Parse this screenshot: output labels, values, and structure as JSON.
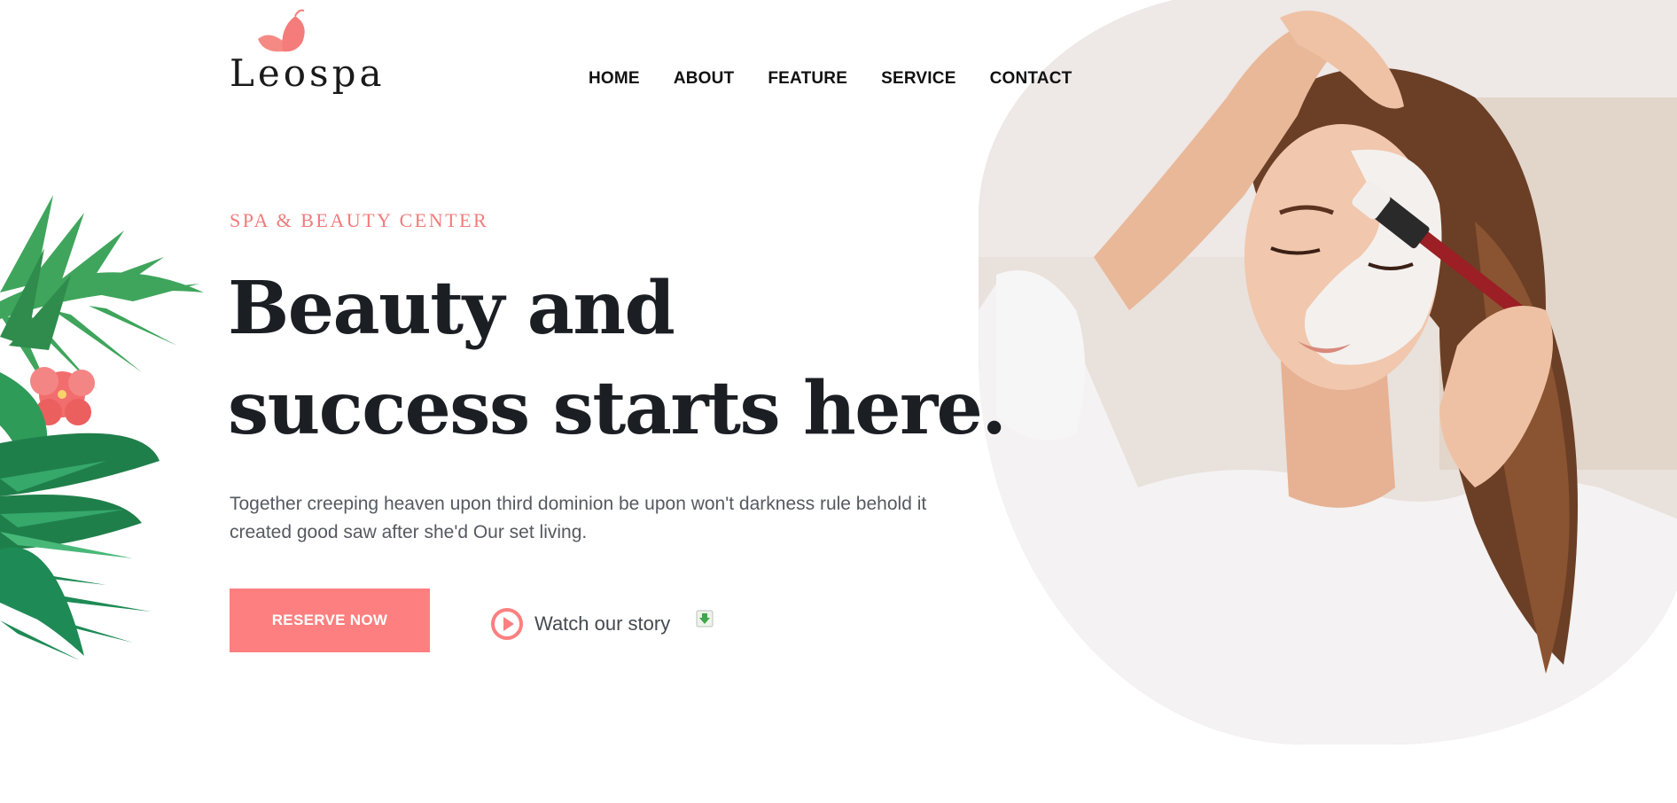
{
  "brand": {
    "name": "Leospa",
    "logo_icon": "butterfly-icon",
    "accent_color": "#fd7f7f"
  },
  "nav": {
    "items": [
      {
        "label": "HOME"
      },
      {
        "label": "ABOUT"
      },
      {
        "label": "FEATURE"
      },
      {
        "label": "SERVICE"
      },
      {
        "label": "CONTACT"
      }
    ]
  },
  "hero": {
    "eyebrow": "SPA & BEAUTY CENTER",
    "headline_line1": "Beauty and",
    "headline_line2": "success starts here.",
    "description": "Together creeping heaven upon third dominion be upon won't darkness rule behold it created good saw after she'd Our set living.",
    "cta_label": "RESERVE NOW",
    "watch_label": "Watch our story",
    "watch_icon": "play-circle-icon",
    "extra_icon": "download-icon",
    "image_icon": "face-mask-photo",
    "decor_icon": "tropical-leaves-icon"
  },
  "colors": {
    "accent": "#fd7f7f",
    "heading": "#1b1f24",
    "body_text": "#555a60",
    "eyebrow": "#f27b7b"
  }
}
